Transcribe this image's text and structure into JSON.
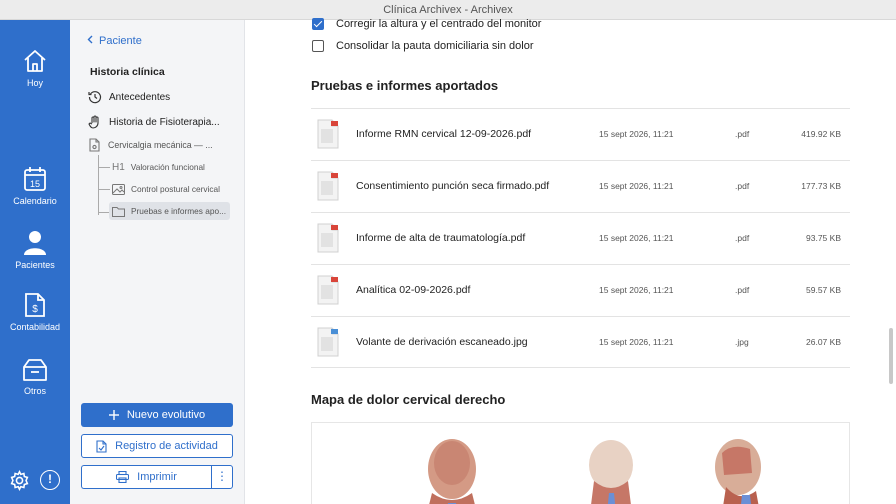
{
  "window": {
    "title": "Clínica Archivex - Archivex"
  },
  "rail": {
    "items": [
      {
        "label": "Hoy",
        "icon": "home-icon"
      },
      {
        "label": "Calendario",
        "icon": "calendar-icon",
        "day": "15"
      },
      {
        "label": "Pacientes",
        "icon": "person-icon"
      },
      {
        "label": "Contabilidad",
        "icon": "accounting-doc-icon"
      },
      {
        "label": "Otros",
        "icon": "box-icon"
      }
    ],
    "info_symbol": "!"
  },
  "side": {
    "back_label": "Paciente",
    "section_title": "Historia clínica",
    "items": [
      {
        "label": "Antecedentes",
        "icon": "history-icon"
      },
      {
        "label": "Historia de Fisioterapia...",
        "icon": "hand-icon"
      },
      {
        "label": "Cervicalgia mecánica — ...",
        "icon": "document-icon"
      }
    ],
    "subitems": [
      {
        "label": "Valoración funcional",
        "icon": "heading-h1-icon",
        "glyph": "H1"
      },
      {
        "label": "Control postural cervical",
        "icon": "image-icon"
      },
      {
        "label": "Pruebas e informes apo...",
        "icon": "folder-icon"
      }
    ],
    "buttons": {
      "new": "Nuevo evolutivo",
      "activity": "Registro de actividad",
      "print": "Imprimir",
      "more": "⋮"
    }
  },
  "main": {
    "checklist": [
      {
        "label": "Corregir la altura y el centrado del monitor",
        "checked": true
      },
      {
        "label": "Consolidar la pauta domiciliaria sin dolor",
        "checked": false
      }
    ],
    "files_title": "Pruebas e informes aportados",
    "files": [
      {
        "name": "Informe RMN cervical 12-09-2026.pdf",
        "date": "15 sept 2026, 11:21",
        "ext": ".pdf",
        "size": "419.92 KB",
        "type": "pdf"
      },
      {
        "name": "Consentimiento punción seca firmado.pdf",
        "date": "15 sept 2026, 11:21",
        "ext": ".pdf",
        "size": "177.73 KB",
        "type": "pdf"
      },
      {
        "name": "Informe de alta de traumatología.pdf",
        "date": "15 sept 2026, 11:21",
        "ext": ".pdf",
        "size": "93.75 KB",
        "type": "pdf"
      },
      {
        "name": "Analítica 02-09-2026.pdf",
        "date": "15 sept 2026, 11:21",
        "ext": ".pdf",
        "size": "59.57 KB",
        "type": "pdf"
      },
      {
        "name": "Volante de derivación escaneado.jpg",
        "date": "15 sept 2026, 11:21",
        "ext": ".jpg",
        "size": "26.07 KB",
        "type": "jpg"
      }
    ],
    "map_title": "Mapa de dolor cervical derecho"
  },
  "colors": {
    "accent": "#2f6fcb",
    "pdf_red": "#d9453a"
  }
}
